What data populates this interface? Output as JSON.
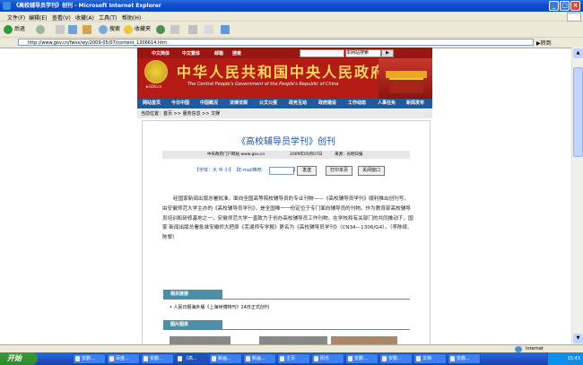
{
  "window": {
    "title": "《高校辅导员学刊》创刊 - Microsoft Internet Explorer"
  },
  "menu": [
    "文件(F)",
    "编辑(E)",
    "查看(V)",
    "收藏(A)",
    "工具(T)",
    "帮助(H)"
  ],
  "toolbar": {
    "back": "后退",
    "search": "搜索",
    "favorites": "收藏夹"
  },
  "address": {
    "url": "http://www.gov.cn/fwxx/wy/2009-05/07/content_1306614.htm",
    "go": "转到"
  },
  "banner": {
    "links": [
      "中文简体",
      "中文繁体",
      "邮箱",
      "搜索"
    ],
    "select": "本网站搜索",
    "gov_cn": "★GOV.cn",
    "title": "中华人民共和国中央人民政府",
    "subtitle": "The Central People's Government of the People's Republic of China"
  },
  "nav": [
    "网站首页",
    "今日中国",
    "中国概况",
    "法律法规",
    "公文公报",
    "政务互动",
    "政府建设",
    "工作动态",
    "人事任免",
    "新闻发布"
  ],
  "breadcrumb": {
    "prefix": "当前位置：",
    "home": "首页",
    "sep": " >> ",
    "section": "服务信息",
    "leaf": "文娱"
  },
  "article": {
    "title": "《高校辅导员学刊》创刊",
    "meta_site": "中央政府门户网站   www.gov.cn",
    "meta_date": "2009年05月07日",
    "meta_source": "来源：光明日报",
    "font_label": "【字体：",
    "font_big": "大",
    "font_mid": "中",
    "font_small": "小",
    "font_end": "】",
    "email_label": "【E-mail推荐：",
    "email_end": "】",
    "send": "发送",
    "print": "打印本页",
    "close": "关闭窗口",
    "body": "经国家新闻出版总署批准，面向全国高等院校辅导员的专业刊物——《高校辅导员学刊》顺利推出创刊号。由安徽师范大学主办的《高校辅导员学刊》，是全国唯一一份定位于专门面向辅导员的刊物。作为教育部高校辅导员培训和研修基地之一，安徽师范大学一直致力于创办高校辅导员工作刊物。在学校和有关部门的共同推动下，国家 新闻出版总署批准安徽师大把原《芜湖师专学报》更名为《高校辅导员学刊》（CN34—1306/G4）。（李陈续、陈黎）"
  },
  "related": {
    "heading": "相关链接",
    "item": "• 人民日报海外版《上海世博特刊》24日正式创刊"
  },
  "photos": {
    "heading": "图片图表"
  },
  "status": {
    "zone": "Internet"
  },
  "taskbar": {
    "start": "开始",
    "tasks": [
      "安鹏...",
      "百度...",
      "安鹏...",
      "《高...",
      "新画...",
      "新画...",
      "主页",
      "阳光",
      "安鹏...",
      "安鹏...",
      "文档",
      "安鹏..."
    ],
    "clock": "15:43"
  }
}
